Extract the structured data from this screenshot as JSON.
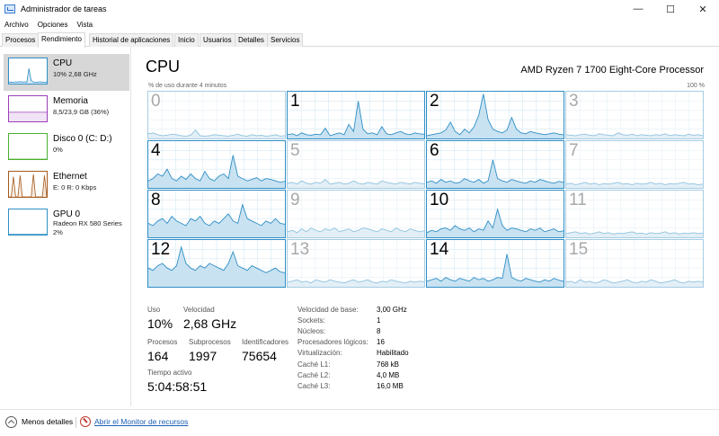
{
  "window": {
    "title": "Administrador de tareas",
    "minimize_icon": "minimize-icon",
    "maximize_icon": "maximize-icon",
    "close_icon": "close-icon"
  },
  "menu": [
    "Archivo",
    "Opciones",
    "Vista"
  ],
  "tabs": [
    {
      "label": "Procesos"
    },
    {
      "label": "Rendimiento"
    },
    {
      "label": "Historial de aplicaciones"
    },
    {
      "label": "Inicio"
    },
    {
      "label": "Usuarios"
    },
    {
      "label": "Detalles"
    },
    {
      "label": "Servicios"
    }
  ],
  "sidebar": [
    {
      "title": "CPU",
      "sub1": "10% 2,68 GHz",
      "sub2": "",
      "color": "#2f8fc6",
      "fill": "#d8eaf6"
    },
    {
      "title": "Memoria",
      "sub1": "8,5/23,9 GB (36%)",
      "sub2": "",
      "color": "#9b3fb5",
      "fill": "#f1e3f6"
    },
    {
      "title": "Disco 0 (C: D:)",
      "sub1": "0%",
      "sub2": "",
      "color": "#4caf2f",
      "fill": "#ffffff"
    },
    {
      "title": "Ethernet",
      "sub1": "E: 0 R: 0 Kbps",
      "sub2": "",
      "color": "#a45a1c",
      "fill": "#f6e8dc"
    },
    {
      "title": "GPU 0",
      "sub1": "Radeon RX 580 Series",
      "sub2": "2%",
      "color": "#2f8fc6",
      "fill": "#ffffff"
    }
  ],
  "main": {
    "title": "CPU",
    "processor": "AMD Ryzen 7 1700 Eight-Core Processor",
    "usage_label": "% de uso durante 4 minutos",
    "max_label": "100 %",
    "line_color": "#2f8fc6",
    "fill_color": "#c9e2f1",
    "grid_color": "#d4e8f4"
  },
  "cores": [
    {
      "label": "0",
      "active": false,
      "values": [
        10,
        12,
        8,
        6,
        7,
        9,
        8,
        6,
        5,
        7,
        18,
        6,
        5,
        6,
        8,
        7,
        6,
        5,
        7,
        9,
        6,
        5,
        8,
        6,
        7,
        5,
        6,
        8,
        5,
        6
      ]
    },
    {
      "label": "1",
      "active": true,
      "values": [
        8,
        10,
        6,
        12,
        8,
        7,
        9,
        8,
        22,
        6,
        9,
        12,
        8,
        30,
        15,
        80,
        20,
        10,
        12,
        8,
        25,
        10,
        8,
        12,
        15,
        10,
        8,
        12,
        10,
        9
      ]
    },
    {
      "label": "2",
      "active": true,
      "values": [
        6,
        8,
        10,
        12,
        18,
        35,
        15,
        8,
        20,
        12,
        25,
        50,
        95,
        40,
        20,
        15,
        12,
        18,
        45,
        20,
        12,
        10,
        15,
        12,
        10,
        8,
        10,
        12,
        9,
        8
      ]
    },
    {
      "label": "3",
      "active": false,
      "values": [
        8,
        7,
        6,
        8,
        9,
        7,
        6,
        10,
        8,
        7,
        6,
        12,
        8,
        7,
        9,
        6,
        8,
        7,
        6,
        8,
        7,
        10,
        6,
        8,
        7,
        6,
        9,
        7,
        8,
        6
      ]
    },
    {
      "label": "4",
      "active": true,
      "values": [
        15,
        20,
        30,
        25,
        40,
        20,
        15,
        25,
        18,
        30,
        20,
        15,
        35,
        20,
        15,
        25,
        30,
        20,
        70,
        25,
        20,
        15,
        18,
        22,
        15,
        20,
        18,
        15,
        12,
        14
      ]
    },
    {
      "label": "5",
      "active": false,
      "values": [
        10,
        12,
        8,
        15,
        10,
        8,
        12,
        10,
        18,
        8,
        10,
        12,
        8,
        10,
        15,
        10,
        8,
        12,
        10,
        8,
        15,
        12,
        10,
        8,
        12,
        10,
        8,
        12,
        10,
        9
      ]
    },
    {
      "label": "6",
      "active": true,
      "values": [
        12,
        15,
        10,
        18,
        12,
        15,
        10,
        12,
        20,
        15,
        12,
        18,
        10,
        15,
        60,
        20,
        15,
        12,
        18,
        15,
        12,
        10,
        15,
        12,
        18,
        15,
        12,
        10,
        14,
        12
      ]
    },
    {
      "label": "7",
      "active": false,
      "values": [
        8,
        10,
        7,
        9,
        12,
        8,
        10,
        7,
        9,
        8,
        10,
        12,
        8,
        9,
        7,
        10,
        8,
        9,
        12,
        8,
        10,
        7,
        9,
        8,
        10,
        12,
        8,
        9,
        7,
        8
      ]
    },
    {
      "label": "8",
      "active": true,
      "values": [
        30,
        25,
        35,
        40,
        30,
        45,
        35,
        30,
        25,
        40,
        35,
        45,
        30,
        25,
        35,
        30,
        40,
        50,
        35,
        30,
        70,
        40,
        35,
        30,
        25,
        35,
        30,
        40,
        30,
        28
      ]
    },
    {
      "label": "9",
      "active": false,
      "values": [
        12,
        15,
        10,
        18,
        12,
        20,
        15,
        12,
        18,
        15,
        20,
        12,
        15,
        18,
        12,
        15,
        20,
        18,
        15,
        12,
        18,
        15,
        12,
        20,
        15,
        12,
        18,
        15,
        12,
        14
      ]
    },
    {
      "label": "10",
      "active": true,
      "values": [
        10,
        15,
        12,
        18,
        20,
        15,
        25,
        18,
        15,
        20,
        12,
        18,
        15,
        35,
        20,
        60,
        25,
        15,
        20,
        18,
        15,
        12,
        18,
        15,
        20,
        12,
        15,
        18,
        12,
        14
      ]
    },
    {
      "label": "11",
      "active": false,
      "values": [
        8,
        10,
        12,
        8,
        10,
        7,
        9,
        12,
        8,
        10,
        7,
        9,
        8,
        10,
        12,
        8,
        9,
        7,
        10,
        8,
        9,
        12,
        8,
        10,
        7,
        9,
        8,
        10,
        8,
        9
      ]
    },
    {
      "label": "12",
      "active": true,
      "values": [
        40,
        35,
        45,
        50,
        40,
        35,
        45,
        85,
        50,
        40,
        35,
        45,
        40,
        50,
        45,
        40,
        35,
        50,
        75,
        45,
        40,
        35,
        45,
        40,
        35,
        30,
        35,
        40,
        32,
        30
      ]
    },
    {
      "label": "13",
      "active": false,
      "values": [
        10,
        12,
        15,
        10,
        12,
        8,
        15,
        12,
        10,
        15,
        12,
        10,
        8,
        12,
        15,
        10,
        12,
        15,
        10,
        8,
        12,
        10,
        15,
        12,
        10,
        8,
        12,
        10,
        12,
        11
      ]
    },
    {
      "label": "14",
      "active": true,
      "values": [
        12,
        15,
        18,
        12,
        20,
        15,
        12,
        18,
        15,
        12,
        20,
        15,
        18,
        12,
        15,
        20,
        18,
        70,
        20,
        15,
        12,
        18,
        15,
        12,
        10,
        15,
        12,
        18,
        14,
        12
      ]
    },
    {
      "label": "15",
      "active": false,
      "values": [
        10,
        12,
        8,
        15,
        10,
        12,
        8,
        10,
        15,
        12,
        8,
        10,
        12,
        15,
        10,
        8,
        12,
        10,
        15,
        12,
        8,
        10,
        12,
        15,
        10,
        8,
        12,
        10,
        12,
        10
      ]
    }
  ],
  "stats": {
    "uso_label": "Uso",
    "uso": "10%",
    "velocidad_label": "Velocidad",
    "velocidad": "2,68 GHz",
    "procesos_label": "Procesos",
    "procesos": "164",
    "subprocesos_label": "Subprocesos",
    "subprocesos": "1997",
    "identificadores_label": "Identificadores",
    "identificadores": "75654",
    "tiempo_label": "Tiempo activo",
    "tiempo": "5:04:58:51"
  },
  "info": [
    {
      "label": "Velocidad de base:",
      "value": "3,00 GHz"
    },
    {
      "label": "Sockets:",
      "value": "1"
    },
    {
      "label": "Núcleos:",
      "value": "8"
    },
    {
      "label": "Procesadores lógicos:",
      "value": "16"
    },
    {
      "label": "Virtualización:",
      "value": "Habilitado"
    },
    {
      "label": "Caché L1:",
      "value": "768 kB"
    },
    {
      "label": "Caché L2:",
      "value": "4,0 MB"
    },
    {
      "label": "Caché L3:",
      "value": "16,0 MB"
    }
  ],
  "footer": {
    "less_details": "Menos detalles",
    "open_monitor": "Abrir el Monitor de recursos"
  }
}
